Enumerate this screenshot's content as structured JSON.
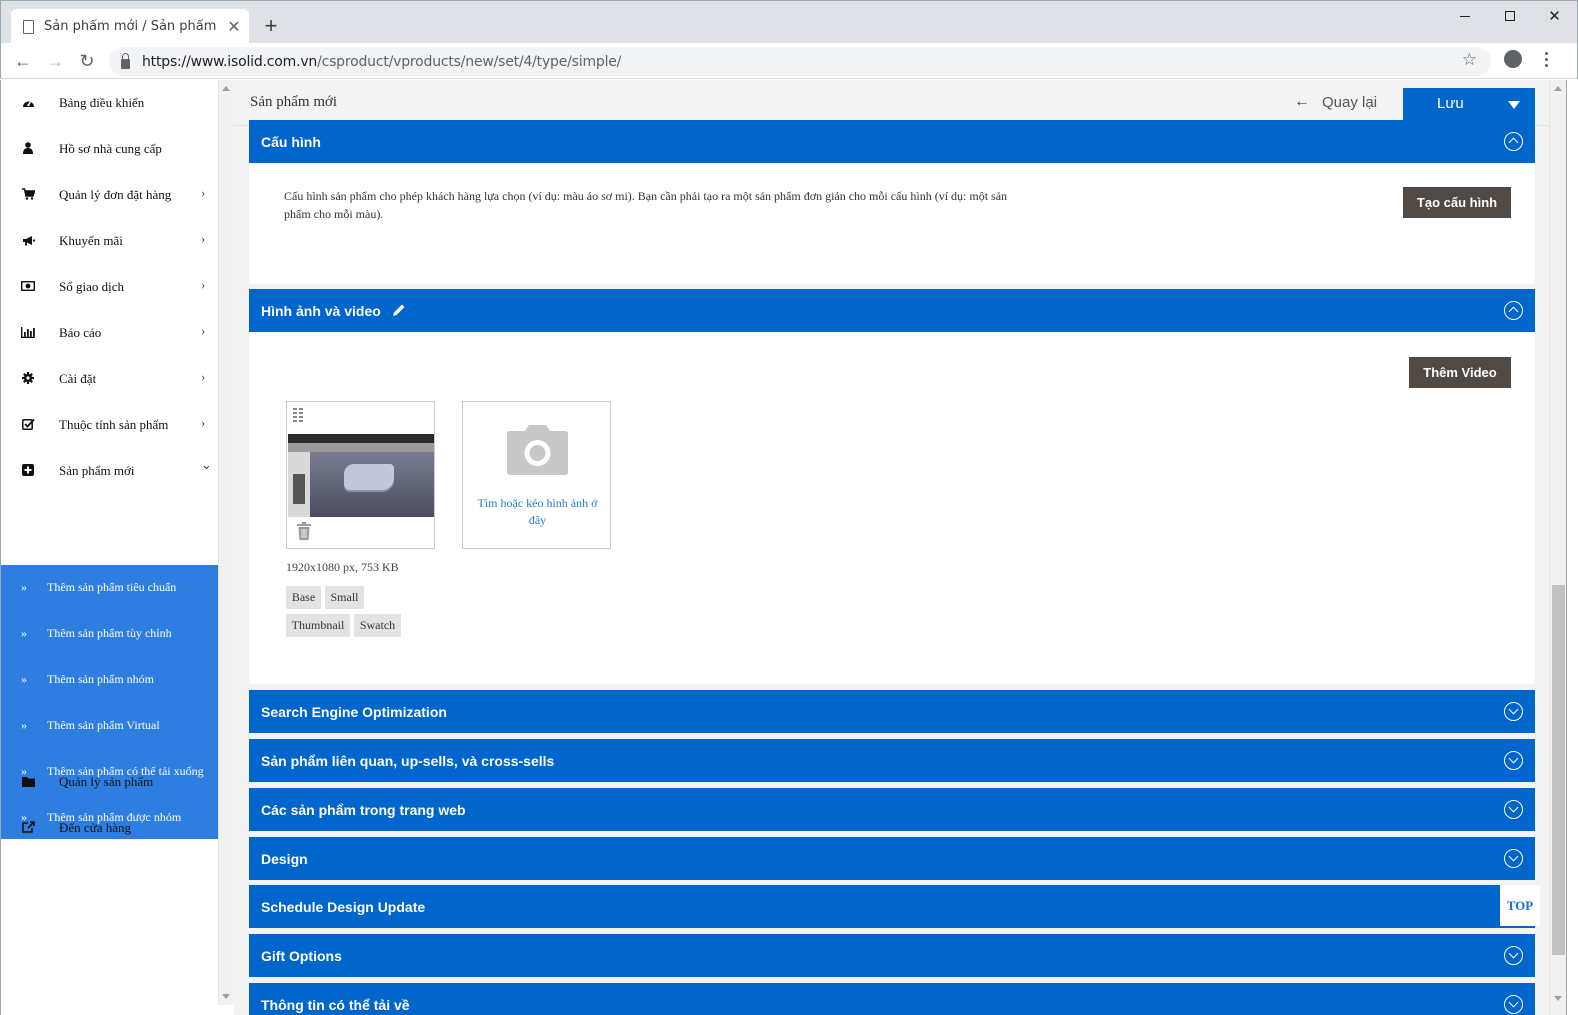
{
  "browser": {
    "tab_title": "Sản phẩm mới / Sản phẩm /",
    "url_host": "https://www.isolid.com.vn",
    "url_path": "/csproduct/vproducts/new/set/4/type/simple/"
  },
  "sidebar": {
    "items": [
      {
        "label": "Bảng điều khiển",
        "icon": "dashboard-icon",
        "chevron": ""
      },
      {
        "label": "Hồ sơ nhà cung cấp",
        "icon": "user-icon",
        "chevron": ""
      },
      {
        "label": "Quản lý đơn đặt hàng",
        "icon": "cart-icon",
        "chevron": "›"
      },
      {
        "label": "Khuyến mãi",
        "icon": "megaphone-icon",
        "chevron": "›"
      },
      {
        "label": "Sổ giao dịch",
        "icon": "money-icon",
        "chevron": "›"
      },
      {
        "label": "Báo cáo",
        "icon": "bar-chart-icon",
        "chevron": "›"
      },
      {
        "label": "Cài đặt",
        "icon": "gear-icon",
        "chevron": "›"
      },
      {
        "label": "Thuộc tính sản phẩm",
        "icon": "checkbox-icon",
        "chevron": "›"
      },
      {
        "label": "Sản phẩm mới",
        "icon": "plus-square-icon",
        "chevron": "⌄"
      }
    ],
    "sub_items": [
      "Thêm sản phẩm tiêu chuẩn",
      "Thêm sản phẩm tùy chỉnh",
      "Thêm sản phẩm nhóm",
      "Thêm sản phẩm Virtual",
      "Thêm sản phẩm có thể tải xuống",
      "Thêm sản phẩm được nhóm"
    ],
    "bottom_items": [
      {
        "label": "Quản lý sản phẩm",
        "icon": "folder-icon"
      },
      {
        "label": "Đến cửa hàng",
        "icon": "external-link-icon"
      }
    ]
  },
  "header": {
    "title": "Sản phẩm mới",
    "back_label": "Quay lại",
    "save_label": "Lưu"
  },
  "config": {
    "title": "Cấu hình",
    "description": "Cấu hình sản phẩm cho phép khách hàng lựa chọn (ví dụ: màu áo sơ mi). Bạn cần phải tạo ra một sản phẩm đơn giản cho mỗi cấu hình (ví dụ: một sản phẩm cho mỗi màu).",
    "button": "Tạo cấu hình"
  },
  "media": {
    "title": "Hình ảnh và video",
    "add_video": "Thêm Video",
    "image_meta": "1920x1080 px, 753 KB",
    "roles": [
      "Base",
      "Small",
      "Thumbnail",
      "Swatch"
    ],
    "upload_text": "Tìm hoặc kéo hình ảnh ở đây"
  },
  "sections": [
    "Search Engine Optimization",
    "Sản phẩm liên quan, up-sells, và cross-sells",
    "Các sản phẩm trong trang web",
    "Design",
    "Schedule Design Update",
    "Gift Options",
    "Thông tin có thể tải về"
  ],
  "top_button": "TOP",
  "colors": {
    "accent": "#0066cc",
    "submenu": "#2d7ee0",
    "dark_button": "#514943"
  }
}
